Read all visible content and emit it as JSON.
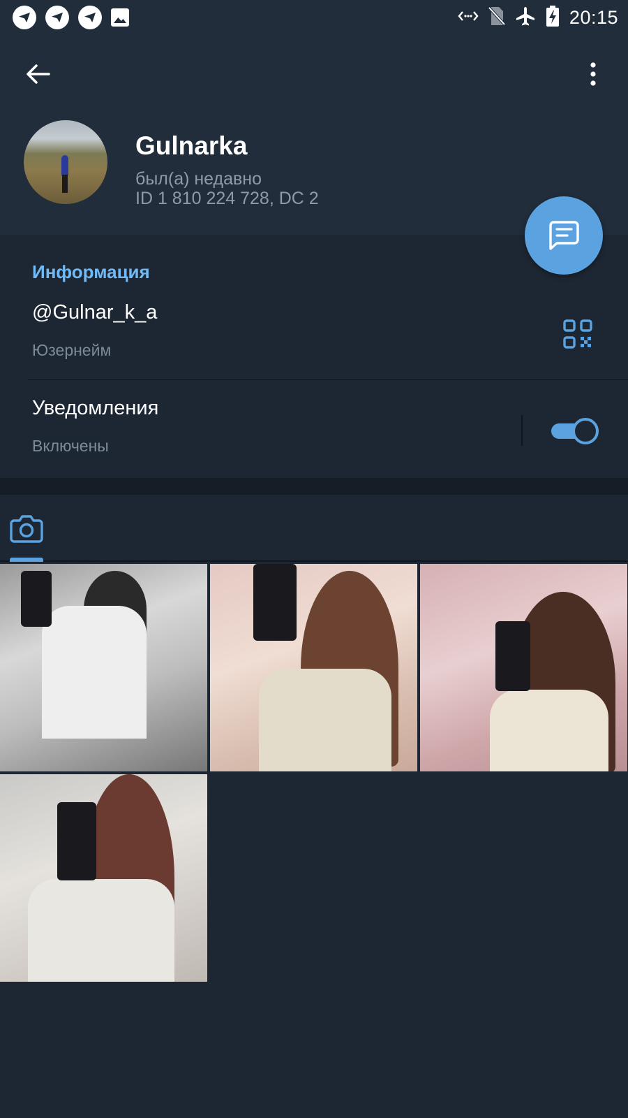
{
  "status_bar": {
    "time": "20:15",
    "left_icons": [
      "app-notification-icon",
      "app-notification-icon",
      "app-notification-icon",
      "image-icon"
    ],
    "right_icons": [
      "data-transfer-icon",
      "no-sim-icon",
      "airplane-icon",
      "battery-charging-icon"
    ]
  },
  "header": {
    "name": "Gulnarka",
    "status": "был(а) недавно",
    "id_line": "ID 1 810 224 728, DC 2"
  },
  "info": {
    "title": "Информация",
    "username": "@Gulnar_k_a",
    "username_label": "Юзернейм",
    "notifications": "Уведомления",
    "notifications_state": "Включены",
    "notifications_enabled": true
  },
  "media": {
    "active_tab": "photos",
    "photo_count": 4
  },
  "colors": {
    "accent": "#5aa3e0",
    "section_title": "#71baf5",
    "background": "#1d2733",
    "header_bg": "#212d3b"
  }
}
